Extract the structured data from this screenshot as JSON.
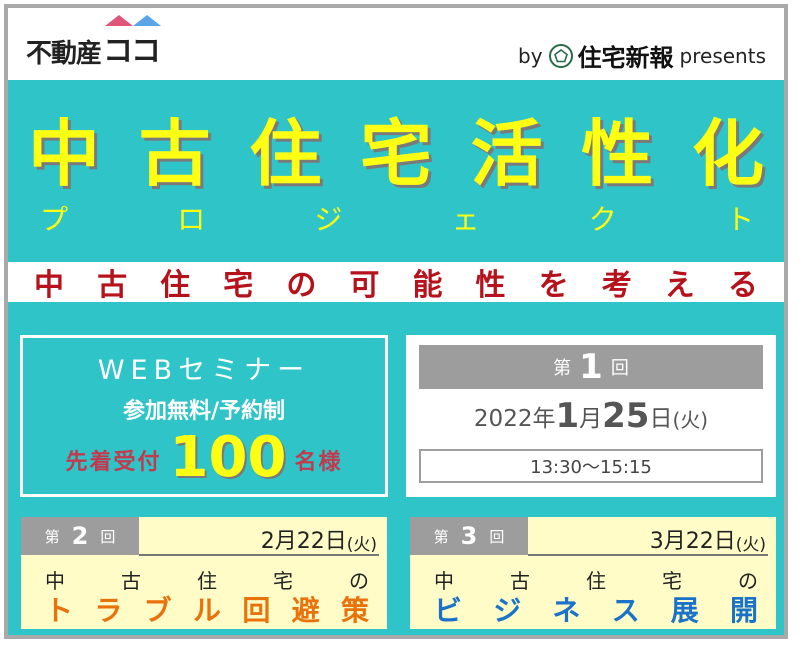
{
  "header": {
    "logo_main": "不動産",
    "logo_koko": "ココ",
    "by": "by",
    "paper_name": "住宅新報",
    "presents": "presents"
  },
  "title": {
    "chars": [
      "中",
      "古",
      "住",
      "宅",
      "活",
      "性",
      "化"
    ],
    "kana": [
      "プ",
      "ロ",
      "ジ",
      "ェ",
      "ク",
      "ト"
    ]
  },
  "tagline": {
    "chars": [
      "中",
      "古",
      "住",
      "宅",
      "の",
      "可",
      "能",
      "性",
      "を",
      "考",
      "え",
      "る"
    ]
  },
  "seminar": {
    "title": "WEBセミナー",
    "sub": "参加無料/予約制",
    "cap_pre": "先着受付",
    "cap_num": "100",
    "cap_post": "名様"
  },
  "round1": {
    "dai": "第",
    "num": "1",
    "kai": "回",
    "year": "2022年",
    "month": "1",
    "month_unit": "月",
    "day": "25",
    "day_unit": "日",
    "weekday": "(火)",
    "time": "13:30〜15:15"
  },
  "round2": {
    "dai": "第",
    "num": "2",
    "kai": "回",
    "date": "2月22日",
    "weekday": "(火)",
    "line1": [
      "中",
      "古",
      "住",
      "宅",
      "の"
    ],
    "line2": [
      "ト",
      "ラ",
      "ブ",
      "ル",
      "回",
      "避",
      "策"
    ]
  },
  "round3": {
    "dai": "第",
    "num": "3",
    "kai": "回",
    "date": "3月22日",
    "weekday": "(火)",
    "line1": [
      "中",
      "古",
      "住",
      "宅",
      "の"
    ],
    "line2": [
      "ビ",
      "ジ",
      "ネ",
      "ス",
      "展",
      "開"
    ]
  },
  "colors": {
    "teal": "#2ec4c8",
    "yellow": "#ffff14",
    "red": "#b5121b",
    "orange": "#e8720c",
    "blue": "#1a72c9",
    "gray": "#9d9d9d",
    "cream": "#fffcc8"
  }
}
